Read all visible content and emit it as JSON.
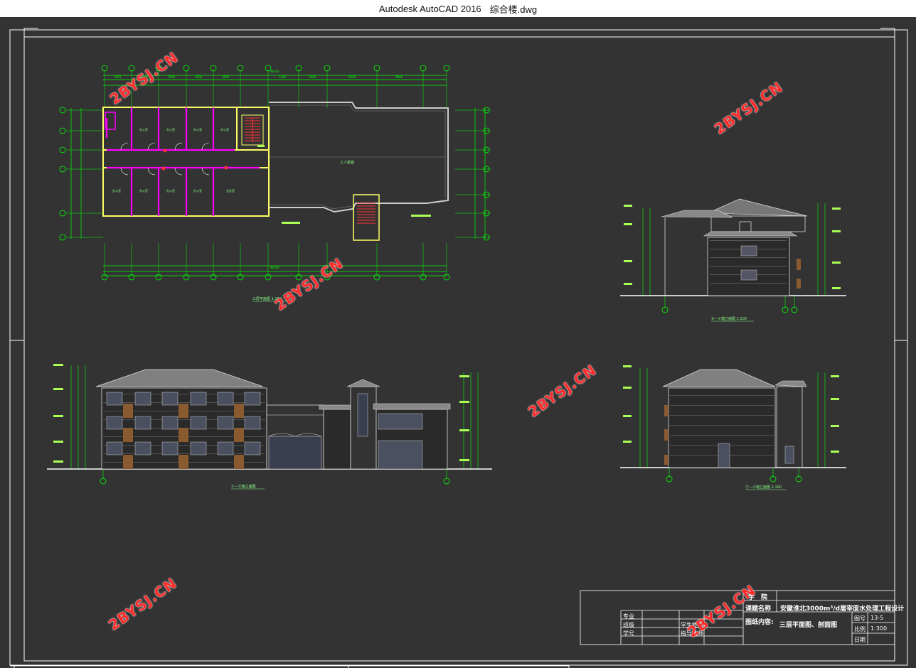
{
  "window": {
    "app_name": "Autodesk AutoCAD 2016",
    "file_name": "综合楼.dwg"
  },
  "watermark": "2BYSJ.CN",
  "drawings": {
    "plan_caption": "三层平面图 1:150",
    "side_elev_top_caption": "⑥—①轴立面图 1:100",
    "front_elev_caption": "①—⑫轴立面图",
    "side_elev_bottom_caption": "Ⓕ—Ⓐ轴立面图 1:100",
    "plan_label_stair": "上人屋面"
  },
  "title_block": {
    "school_label": "学　院",
    "project_label": "课题名称",
    "project_value": "安徽淮北3000m³/d屠宰废水处理工程设计",
    "content_label": "图纸内容:",
    "content_value": "三层平面图、剖面图",
    "drawing_no_label": "图号",
    "drawing_no_value": "13-5",
    "scale_label": "比例",
    "scale_value": "1:300",
    "date_label": "日期",
    "major_label": "专业",
    "class_label": "班级",
    "student_no_label": "学号",
    "student_label": "学生姓名",
    "teacher_label": "指导教师"
  },
  "colors": {
    "background": "#333333",
    "frame": "#ffffff",
    "dim_green": "#00ff00",
    "wall_yellow": "#ffff66",
    "door_magenta": "#ff00ff",
    "stair_red": "#ff3333",
    "roof_gray": "#bbbbbb",
    "watermark_red": "#ff2a2a"
  }
}
